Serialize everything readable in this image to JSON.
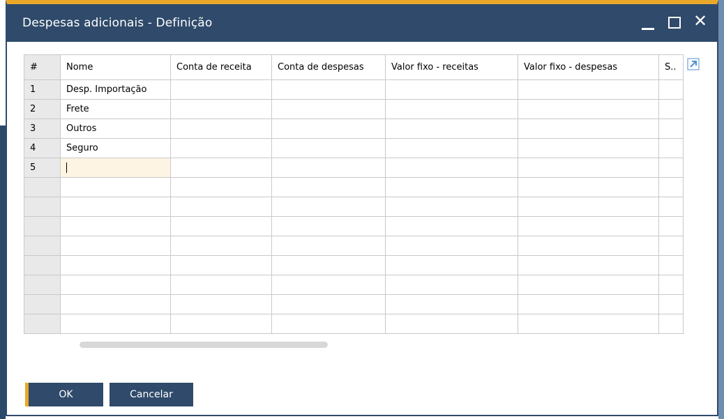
{
  "window": {
    "title": "Despesas adicionais - Definição",
    "controls": {
      "minimize": "minimize",
      "maximize": "maximize",
      "close": "✕"
    }
  },
  "grid": {
    "columns": [
      "#",
      "Nome",
      "Conta de receita",
      "Conta de despesas",
      "Valor fixo - receitas",
      "Valor fixo - despesas",
      "S.."
    ],
    "rows": [
      [
        "1",
        "Desp. Importação",
        "",
        "",
        "",
        "",
        ""
      ],
      [
        "2",
        "Frete",
        "",
        "",
        "",
        "",
        ""
      ],
      [
        "3",
        "Outros",
        "",
        "",
        "",
        "",
        ""
      ],
      [
        "4",
        "Seguro",
        "",
        "",
        "",
        "",
        ""
      ],
      [
        "5",
        "",
        "",
        "",
        "",
        "",
        ""
      ],
      [
        "",
        "",
        "",
        "",
        "",
        "",
        ""
      ],
      [
        "",
        "",
        "",
        "",
        "",
        "",
        ""
      ],
      [
        "",
        "",
        "",
        "",
        "",
        "",
        ""
      ],
      [
        "",
        "",
        "",
        "",
        "",
        "",
        ""
      ],
      [
        "",
        "",
        "",
        "",
        "",
        "",
        ""
      ],
      [
        "",
        "",
        "",
        "",
        "",
        "",
        ""
      ],
      [
        "",
        "",
        "",
        "",
        "",
        "",
        ""
      ],
      [
        "",
        "",
        "",
        "",
        "",
        "",
        ""
      ]
    ],
    "active_cell": {
      "row": 4,
      "col": 1
    }
  },
  "buttons": {
    "ok": "OK",
    "cancel": "Cancelar"
  },
  "icons": {
    "expand": "expand-arrow-icon"
  },
  "colors": {
    "titlebar": "#2f4a6a",
    "accent": "#eaa82b",
    "active_cell": "#fdf4e4",
    "rownum_bg": "#e9e9e9"
  }
}
